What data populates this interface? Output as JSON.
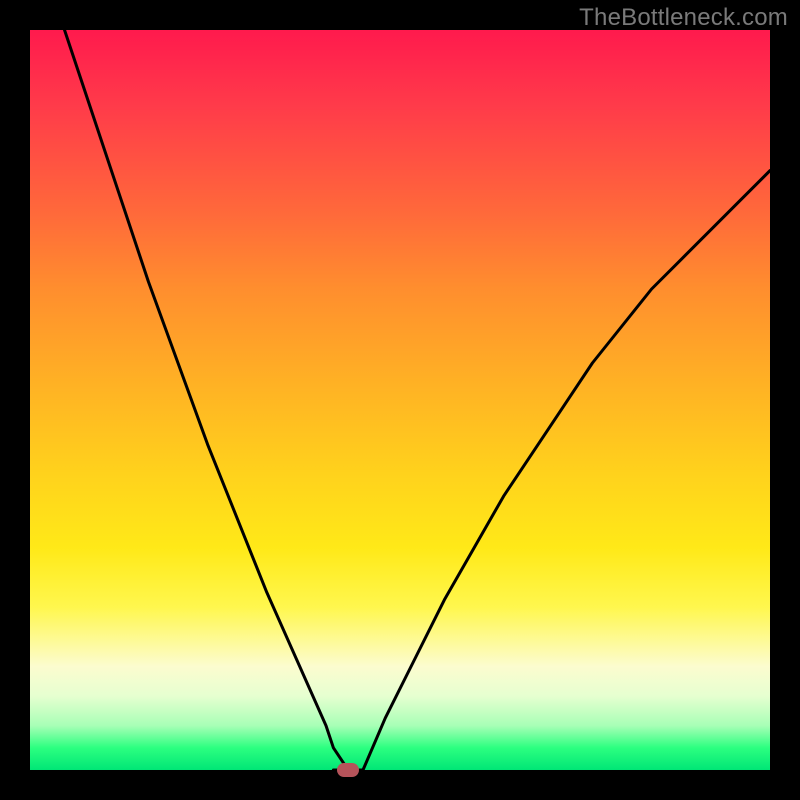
{
  "watermark": "TheBottleneck.com",
  "colors": {
    "frame": "#000000",
    "gradient_top": "#ff1a4d",
    "gradient_bottom": "#00e676",
    "curve": "#000000",
    "marker": "#b5535a"
  },
  "chart_data": {
    "type": "line",
    "title": "",
    "xlabel": "",
    "ylabel": "",
    "xlim": [
      0,
      100
    ],
    "ylim": [
      0,
      100
    ],
    "grid": false,
    "legend": false,
    "marker": {
      "x": 43,
      "y": 0
    },
    "series": [
      {
        "name": "left-branch",
        "x": [
          0,
          4,
          8,
          12,
          16,
          20,
          24,
          28,
          32,
          36,
          40,
          41,
          43
        ],
        "y": [
          115,
          102,
          90,
          78,
          66,
          55,
          44,
          34,
          24,
          15,
          6,
          3,
          0
        ]
      },
      {
        "name": "bottom-flat",
        "x": [
          41,
          43,
          45
        ],
        "y": [
          0,
          0,
          0
        ]
      },
      {
        "name": "right-branch",
        "x": [
          45,
          48,
          52,
          56,
          60,
          64,
          68,
          72,
          76,
          80,
          84,
          88,
          92,
          96,
          100
        ],
        "y": [
          0,
          7,
          15,
          23,
          30,
          37,
          43,
          49,
          55,
          60,
          65,
          69,
          73,
          77,
          81
        ]
      }
    ],
    "background_gradient_stops": [
      {
        "pos": 0,
        "color": "#ff1a4d"
      },
      {
        "pos": 10,
        "color": "#ff3a4a"
      },
      {
        "pos": 25,
        "color": "#ff6a3a"
      },
      {
        "pos": 35,
        "color": "#ff8e2e"
      },
      {
        "pos": 48,
        "color": "#ffb224"
      },
      {
        "pos": 60,
        "color": "#ffd21c"
      },
      {
        "pos": 70,
        "color": "#ffe918"
      },
      {
        "pos": 78,
        "color": "#fff74e"
      },
      {
        "pos": 86,
        "color": "#fcfccf"
      },
      {
        "pos": 90,
        "color": "#e6ffd0"
      },
      {
        "pos": 94,
        "color": "#a8ffb6"
      },
      {
        "pos": 97,
        "color": "#2cff80"
      },
      {
        "pos": 100,
        "color": "#00e676"
      }
    ]
  }
}
